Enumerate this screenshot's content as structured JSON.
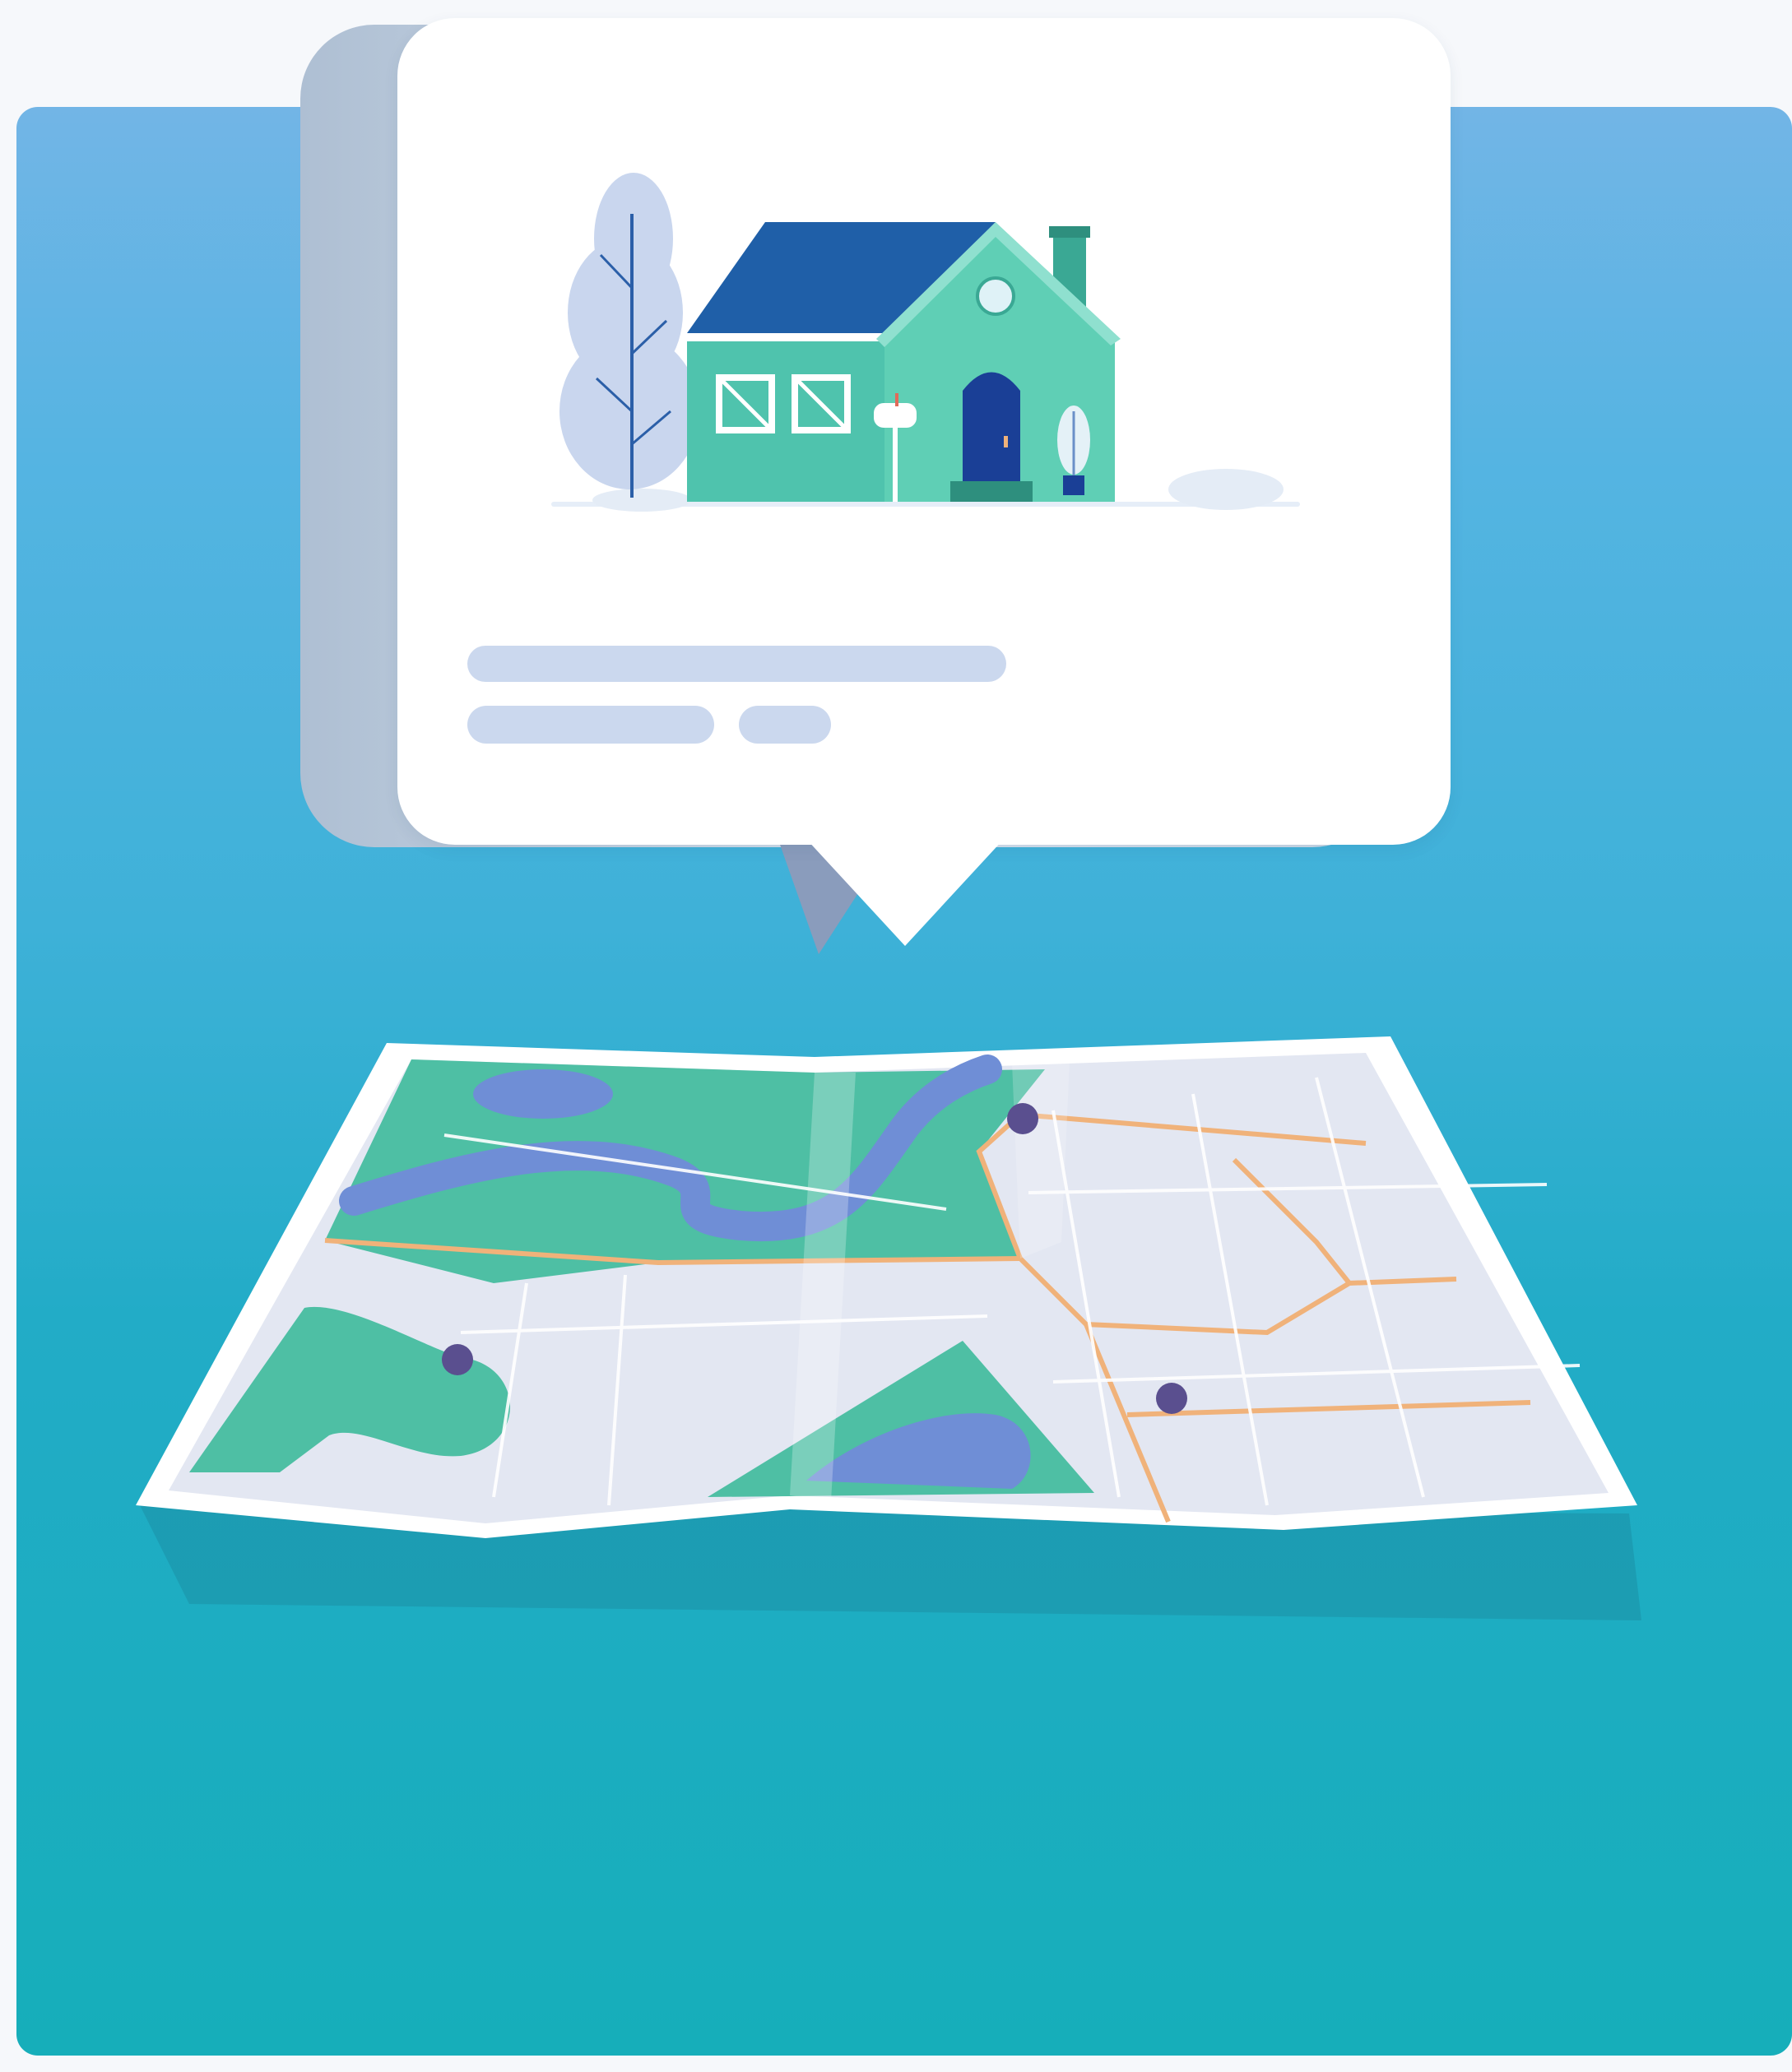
{
  "illustration": {
    "subject": "house-listing-over-map",
    "colors": {
      "background_top": "#72b5e6",
      "background_bottom": "#16aeba",
      "card": "#ffffff",
      "placeholder_line": "#cbd8ee",
      "house_teal": "#4fc3ad",
      "roof_blue": "#1f5fa8",
      "map_green": "#4ebfa4",
      "map_water": "#6f8ed6",
      "map_road": "#f0b27a",
      "map_pin": "#5a4f8f"
    },
    "icons": [
      "house-icon",
      "tree-icon",
      "mailbox-icon",
      "map-pin-icon"
    ]
  },
  "map": {
    "pins": 3
  }
}
